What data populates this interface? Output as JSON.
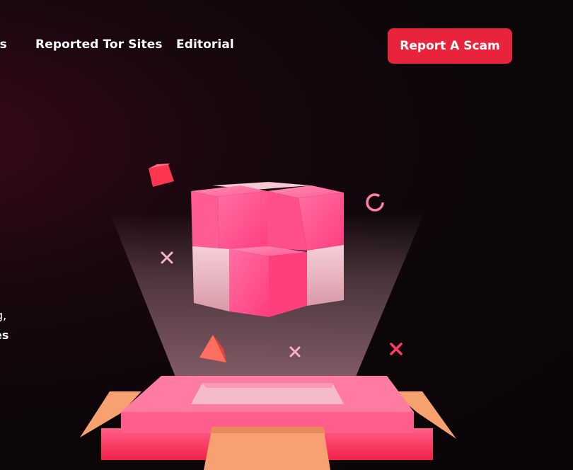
{
  "nav": {
    "items": [
      {
        "label": "es"
      },
      {
        "label": "Reported Tor Sites"
      },
      {
        "label": "Editorial"
      }
    ],
    "cta_label": "Report A Scam"
  },
  "hero_text_fragments": [
    "g,",
    "es"
  ],
  "illustration": {
    "name": "floating-pink-cubes-over-open-box"
  },
  "colors": {
    "accent": "#e8243d",
    "background": "#0a0508"
  }
}
